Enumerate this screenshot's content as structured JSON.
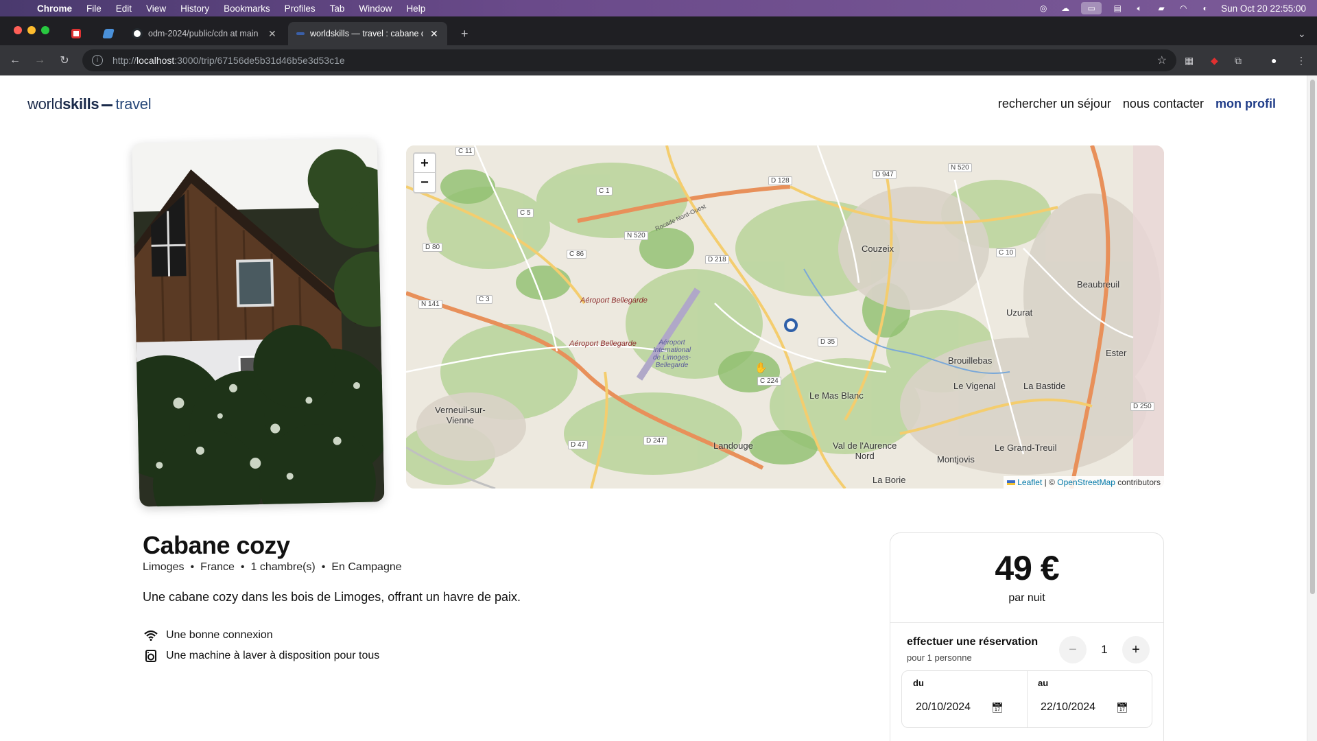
{
  "menubar": {
    "app": "Chrome",
    "items": [
      "File",
      "Edit",
      "View",
      "History",
      "Bookmarks",
      "Profiles",
      "Tab",
      "Window",
      "Help"
    ],
    "clock": "Sun Oct 20  22:55:00"
  },
  "tabs": [
    {
      "title": "odm-2024/public/cdn at main",
      "active": false
    },
    {
      "title": "worldskills — travel : cabane c",
      "active": true
    }
  ],
  "address_bar": {
    "prefix": "http://",
    "host": "localhost",
    "rest": ":3000/trip/67156de5b31d46b5e3d53c1e"
  },
  "site": {
    "logo": {
      "part1": "world",
      "part2": "skills",
      "part3": "travel"
    },
    "nav": [
      "rechercher un séjour",
      "nous contacter",
      "mon profil"
    ]
  },
  "map": {
    "zoom_in": "+",
    "zoom_out": "−",
    "attribution": {
      "leaflet": "Leaflet",
      "sep": " | © ",
      "osm": "OpenStreetMap",
      "tail": " contributors"
    },
    "labels": {
      "c11": "C 11",
      "c1": "C 1",
      "c5": "C 5",
      "d80": "D 80",
      "c86": "C 86",
      "n520a": "N 520",
      "d128": "D 128",
      "d947": "D 947",
      "n520b": "N 520",
      "d218": "D 218",
      "n141": "N 141",
      "c3": "C 3",
      "c10": "C 10",
      "d35": "D 35",
      "c224": "C 224",
      "d247": "D 247",
      "d47": "D 47",
      "d250": "D 250",
      "couzeix": "Couzeix",
      "beaubreuil": "Beaubreuil",
      "uzurat": "Uzurat",
      "ester": "Ester",
      "brouillebas": "Brouillebas",
      "levigenal": "Le Vigenal",
      "labastide": "La Bastide",
      "lemasblanc": "Le Mas Blanc",
      "verneuil": "Verneuil-sur-\nVienne",
      "landouge": "Landouge",
      "valdaurence": "Val de l'Aurence\nNord",
      "montjovis": "Montjovis",
      "legrandtreuil": "Le Grand-Treuil",
      "laborie": "La Borie",
      "aeroport1": "Aéroport Bellegarde",
      "aeroport2": "Aéroport Bellegarde",
      "aeroport_int": "Aéroport\nInternational\nde Limoges-\nBellegarde",
      "rocade": "Rocade Nord-Ouest"
    }
  },
  "trip": {
    "title": "Cabane cozy",
    "meta": [
      "Limoges",
      "France",
      "1 chambre(s)",
      "En Campagne"
    ],
    "meta_sep": "•",
    "description": "Une cabane cozy dans les bois de Limoges, offrant un havre de paix.",
    "amenities": [
      {
        "icon": "wifi-icon",
        "label": "Une bonne connexion"
      },
      {
        "icon": "washing-machine-icon",
        "label": "Une machine à laver à disposition pour tous"
      }
    ]
  },
  "booking": {
    "price": "49 €",
    "price_unit": "par nuit",
    "label": "effectuer une réservation",
    "sublabel": "pour 1 personne",
    "minus": "−",
    "plus": "+",
    "quantity": "1",
    "from_label": "du",
    "from_value": "20/10/2024",
    "to_label": "au",
    "to_value": "22/10/2024"
  }
}
